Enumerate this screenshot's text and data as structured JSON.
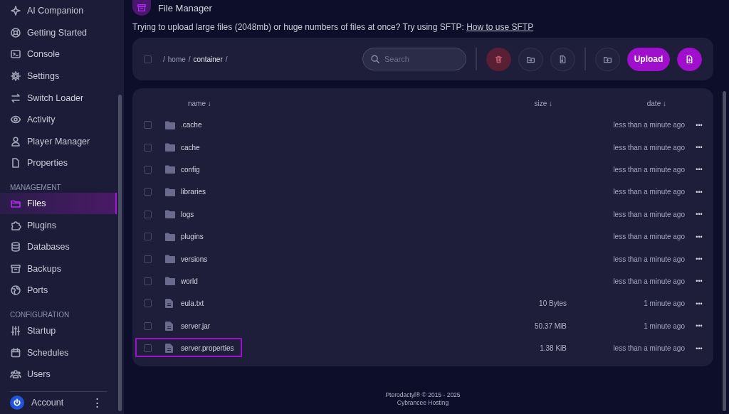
{
  "sidebar": {
    "sections": [
      {
        "items": [
          {
            "label": "AI Companion",
            "selected": false
          },
          {
            "label": "Getting Started",
            "selected": false
          },
          {
            "label": "Console",
            "selected": false
          },
          {
            "label": "Settings",
            "selected": false
          },
          {
            "label": "Switch Loader",
            "selected": false
          },
          {
            "label": "Activity",
            "selected": false
          },
          {
            "label": "Player Manager",
            "selected": false
          },
          {
            "label": "Properties",
            "selected": false
          }
        ]
      },
      {
        "heading": "MANAGEMENT",
        "items": [
          {
            "label": "Files",
            "selected": true
          },
          {
            "label": "Plugins",
            "selected": false
          },
          {
            "label": "Databases",
            "selected": false
          },
          {
            "label": "Backups",
            "selected": false
          },
          {
            "label": "Ports",
            "selected": false
          }
        ]
      },
      {
        "heading": "CONFIGURATION",
        "items": [
          {
            "label": "Startup",
            "selected": false
          },
          {
            "label": "Schedules",
            "selected": false
          },
          {
            "label": "Users",
            "selected": false
          }
        ]
      }
    ],
    "account": {
      "label": "Account",
      "menu": "⋮"
    }
  },
  "page": {
    "title": "File Manager",
    "notice": "Trying to upload large files (2048mb) or huge numbers of files at once? Try using SFTP:",
    "notice_link": "How to use SFTP"
  },
  "toolbar": {
    "select_all": {
      "checked": false
    },
    "breadcrumb": {
      "separator": "/",
      "segments": [
        {
          "label": "home",
          "current": false
        },
        {
          "label": "container",
          "current": true
        }
      ]
    },
    "search": {
      "placeholder": "Search"
    },
    "actions": [
      {
        "kind": "delete"
      },
      {
        "kind": "move"
      },
      {
        "kind": "archive"
      },
      {
        "kind": "new-folder"
      },
      {
        "kind": "upload",
        "label": "Upload"
      },
      {
        "kind": "new-file"
      }
    ]
  },
  "table": {
    "columns": [
      {
        "label": "name",
        "sort": "↓"
      },
      {
        "label": "size",
        "sort": "↓"
      },
      {
        "label": "date",
        "sort": "↓"
      }
    ],
    "rows": [
      {
        "kind": "folder",
        "name": ".cache",
        "date": "less than a minute ago",
        "checked": false,
        "highlighted": false
      },
      {
        "kind": "folder",
        "name": "cache",
        "date": "less than a minute ago",
        "checked": false,
        "highlighted": false
      },
      {
        "kind": "folder",
        "name": "config",
        "date": "less than a minute ago",
        "checked": false,
        "highlighted": false
      },
      {
        "kind": "folder",
        "name": "libraries",
        "date": "less than a minute ago",
        "checked": false,
        "highlighted": false
      },
      {
        "kind": "folder",
        "name": "logs",
        "date": "less than a minute ago",
        "checked": false,
        "highlighted": false
      },
      {
        "kind": "folder",
        "name": "plugins",
        "date": "less than a minute ago",
        "checked": false,
        "highlighted": false
      },
      {
        "kind": "folder",
        "name": "versions",
        "date": "less than a minute ago",
        "checked": false,
        "highlighted": false
      },
      {
        "kind": "folder",
        "name": "world",
        "date": "less than a minute ago",
        "checked": false,
        "highlighted": false
      },
      {
        "kind": "file",
        "name": "eula.txt",
        "size": "10 Bytes",
        "date": "1 minute ago",
        "checked": false,
        "highlighted": false
      },
      {
        "kind": "file",
        "name": "server.jar",
        "size": "50.37 MiB",
        "date": "1 minute ago",
        "checked": false,
        "highlighted": false
      },
      {
        "kind": "file",
        "name": "server.properties",
        "size": "1.38 KiB",
        "date": "less than a minute ago",
        "checked": false,
        "highlighted": true
      }
    ],
    "row_menu": "•••"
  },
  "footer": {
    "lines": [
      "Pterodactyl® © 2015 - 2025",
      "Cybrancee Hosting"
    ]
  }
}
